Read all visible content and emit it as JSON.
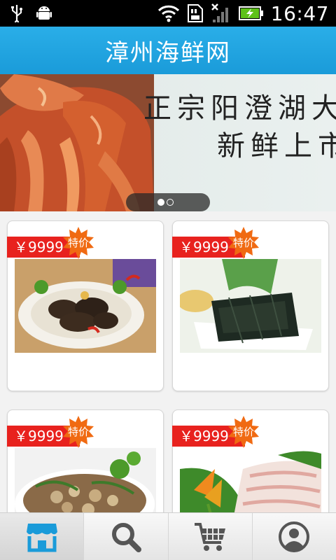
{
  "status_bar": {
    "time": "16:47",
    "icons": [
      "usb-icon",
      "android-debug-icon",
      "wifi-icon",
      "sd-card-icon",
      "no-signal-icon",
      "battery-charging-icon"
    ]
  },
  "header": {
    "title": "漳州海鲜网"
  },
  "banner": {
    "line1": "正宗阳澄湖大",
    "line2": "新鲜上市",
    "slides_total": 2,
    "active_slide": 1
  },
  "products": [
    {
      "price": "￥9999",
      "badge": "特价",
      "image": "sea-cucumber-dish"
    },
    {
      "price": "￥9999",
      "badge": "特价",
      "image": "seaweed-snack"
    },
    {
      "price": "￥9999",
      "badge": "特价",
      "image": "stir-fried-clams"
    },
    {
      "price": "￥9999",
      "badge": "特价",
      "image": "fish-fillet"
    }
  ],
  "bottom_nav": {
    "tabs": [
      {
        "icon": "store-icon",
        "active": true
      },
      {
        "icon": "search-icon",
        "active": false
      },
      {
        "icon": "cart-icon",
        "active": false
      },
      {
        "icon": "profile-icon",
        "active": false
      }
    ]
  },
  "colors": {
    "accent": "#1a9bd9",
    "price_tag": "#e8221e",
    "badge": "#f06a12"
  }
}
